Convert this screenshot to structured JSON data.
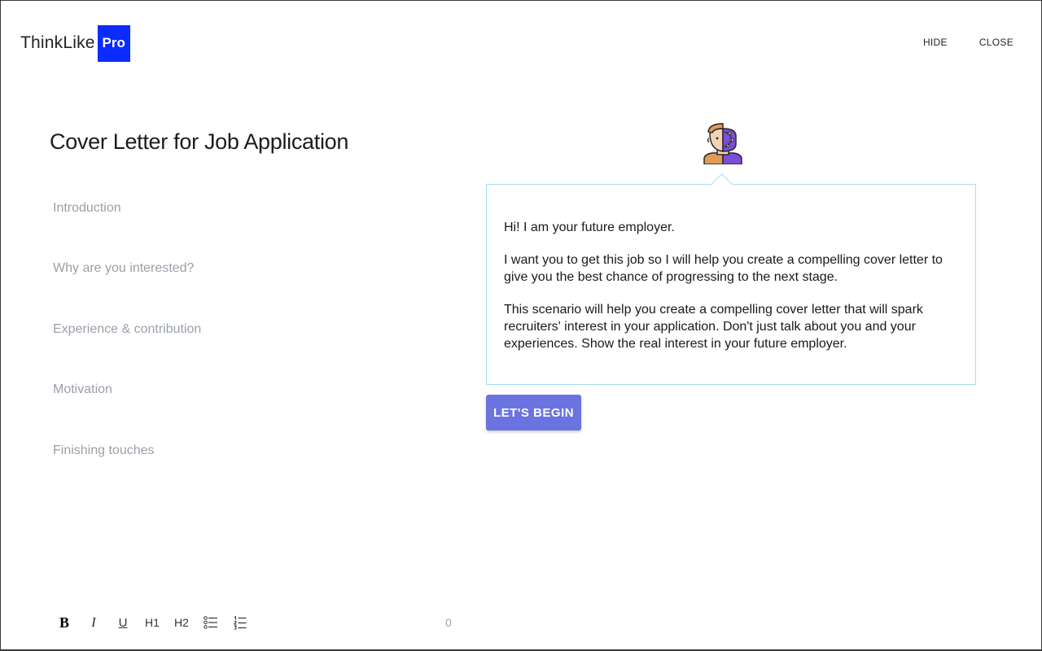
{
  "header": {
    "logo_text": "ThinkLike",
    "logo_badge": "Pro",
    "badge_color": "#0a2cff",
    "hide_label": "HIDE",
    "close_label": "CLOSE"
  },
  "document": {
    "title": "Cover Letter for Job Application",
    "sections": [
      "Introduction",
      "Why are you interested?",
      "Experience & contribution",
      "Motivation",
      "Finishing touches"
    ]
  },
  "toolbar": {
    "bold": "B",
    "italic": "I",
    "underline": "U",
    "h1": "H1",
    "h2": "H2",
    "bullet_list_icon": "bullet-list-icon",
    "numbered_list_icon": "numbered-list-icon",
    "word_count": "0"
  },
  "assistant": {
    "avatar_icon": "robot-person-avatar-icon",
    "messages": [
      "Hi! I am your future employer.",
      "I want you to get this job so I will help you create a compelling cover letter to give you the best chance of progressing to the next stage.",
      "This scenario will help you create a compelling cover letter that will spark recruiters' interest in your application. Don't just talk about you and your experiences. Show the real interest in your future employer."
    ],
    "begin_label": "LET'S BEGIN",
    "button_color": "#6b73e0",
    "bubble_border_color": "#a9ddf0"
  }
}
